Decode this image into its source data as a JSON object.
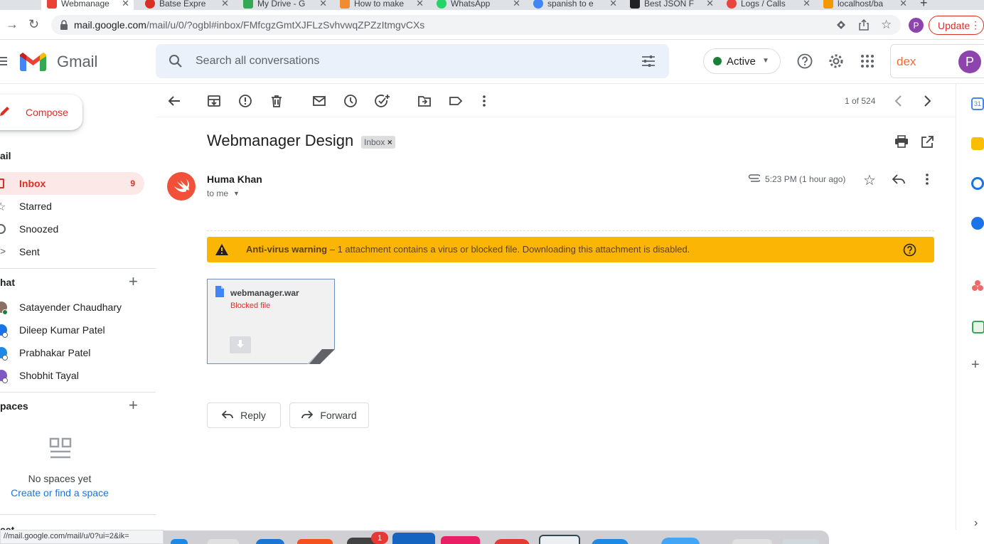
{
  "browser": {
    "tabs": [
      {
        "title": "Webmanage",
        "active": true
      },
      {
        "title": "Batse Expre",
        "active": false
      },
      {
        "title": "My Drive - G",
        "active": false
      },
      {
        "title": "How to make",
        "active": false
      },
      {
        "title": "WhatsApp",
        "active": false
      },
      {
        "title": "spanish to e",
        "active": false
      },
      {
        "title": "Best JSON F",
        "active": false
      },
      {
        "title": "Logs / Calls",
        "active": false
      },
      {
        "title": "localhost/ba",
        "active": false
      }
    ],
    "url_host": "mail.google.com",
    "url_path": "/mail/u/0/?ogbl#inbox/FMfcgzGmtXJFLzSvhvwqZPZzItmgvCXs",
    "profile_initial": "P",
    "update_label": "Update"
  },
  "gmail": {
    "logo_text": "Gmail",
    "search_placeholder": "Search all conversations",
    "status_label": "Active",
    "workspace_brand": "dex",
    "account_initial": "P"
  },
  "sidebar": {
    "compose_label": "Compose",
    "mail_section": "ail",
    "items": [
      {
        "label": "Inbox",
        "count": "9",
        "selected": true
      },
      {
        "label": "Starred",
        "count": "",
        "selected": false
      },
      {
        "label": "Snoozed",
        "count": "",
        "selected": false
      },
      {
        "label": "Sent",
        "count": "",
        "selected": false
      }
    ],
    "chat_section": "hat",
    "chats": [
      {
        "name": "Satayender Chaudhary"
      },
      {
        "name": "Dileep Kumar Patel"
      },
      {
        "name": "Prabhakar Patel"
      },
      {
        "name": "Shobhit Tayal"
      }
    ],
    "spaces_section": "paces",
    "no_spaces_text": "No spaces yet",
    "create_space_link": "Create or find a space",
    "meet_section": "eet"
  },
  "toolbar": {
    "pagination": "1 of 524"
  },
  "message": {
    "subject": "Webmanager Design",
    "label_chip": "Inbox",
    "sender": "Huma Khan",
    "recipient": "to me",
    "time": "5:23 PM (1 hour ago)",
    "warning_title": "Anti-virus warning",
    "warning_text": " – 1 attachment contains a virus or blocked file. Downloading this attachment is disabled.",
    "attachment_name": "webmanager.war",
    "attachment_status": "Blocked file",
    "reply_label": "Reply",
    "forward_label": "Forward"
  },
  "status_bar": {
    "url": "//mail.google.com/mail/u/0?ui=2&ik="
  },
  "dock": {
    "badge": "1"
  },
  "colors": {
    "gmail_red": "#d93025",
    "warning_yellow": "#fbb605",
    "link_blue": "#1a73e8",
    "selected_bg": "#fce8e6"
  }
}
